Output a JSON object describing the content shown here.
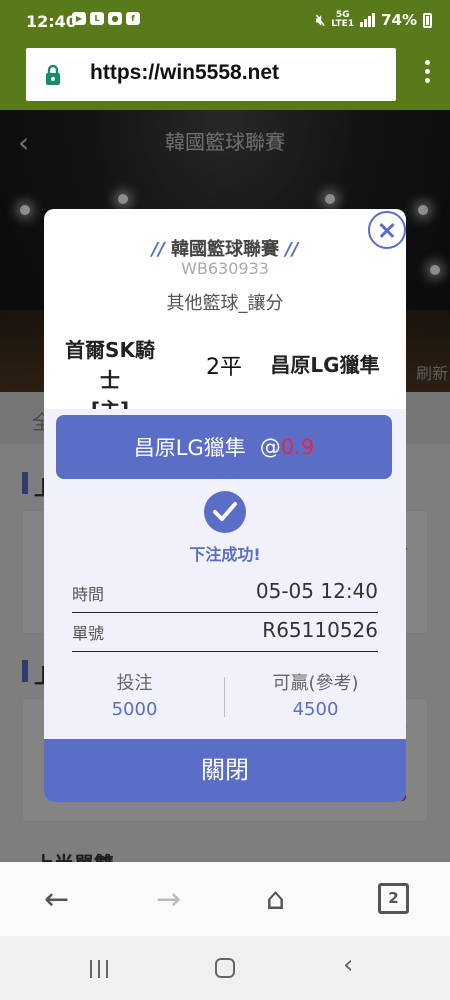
{
  "status_bar": {
    "time": "12:40",
    "battery": "74%",
    "network": "LTE1",
    "network_gen": "5G"
  },
  "browser": {
    "url": "https://win5558.net",
    "tab_count": "2"
  },
  "page": {
    "title": "韓國籃球聯賽",
    "refresh_label": "刷新",
    "tab_label": "全",
    "section_label_1": "上",
    "section_label_2": "上",
    "section_label_3": "上半單雙"
  },
  "modal": {
    "league": "韓國籃球聯賽",
    "league_prefix": "//",
    "league_suffix": "//",
    "event_code": "WB630933",
    "bet_type": "其他籃球_讓分",
    "home_team": "首爾SK騎士",
    "home_tag": "[主]",
    "handicap": "2平",
    "away_team": "昌原LG獵隼",
    "selection": "昌原LG獵隼",
    "odds_prefix": "@",
    "odds": "0.9",
    "success_text": "下注成功!",
    "time_label": "時間",
    "time_value": "05-05 12:40",
    "ticket_label": "單號",
    "ticket_value": "R65110526",
    "stake_label": "投注",
    "stake_value": "5000",
    "win_label": "可贏(參考)",
    "win_value": "4500",
    "close_label": "關閉"
  },
  "colors": {
    "accent": "#5a6ec8",
    "odds": "#e8244a",
    "toolbar": "#597a1a"
  }
}
